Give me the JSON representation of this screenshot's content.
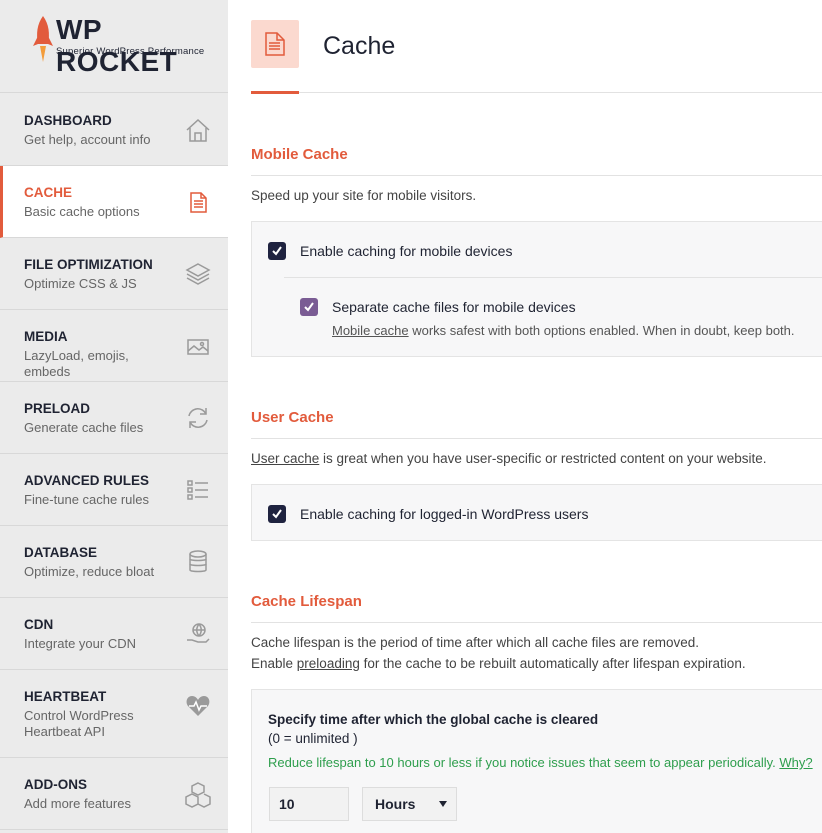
{
  "brand": {
    "logo_text": "WP ROCKET",
    "tagline": "Superior WordPress Performance",
    "accent_color": "#e25b3c"
  },
  "sidebar": {
    "items": [
      {
        "title": "DASHBOARD",
        "desc": "Get help, account info",
        "icon": "home-icon",
        "active": false
      },
      {
        "title": "CACHE",
        "desc": "Basic cache options",
        "icon": "file-icon",
        "active": true
      },
      {
        "title": "FILE OPTIMIZATION",
        "desc": "Optimize CSS & JS",
        "icon": "layers-icon",
        "active": false
      },
      {
        "title": "MEDIA",
        "desc": "LazyLoad, emojis, embeds",
        "icon": "images-icon",
        "active": false
      },
      {
        "title": "PRELOAD",
        "desc": "Generate cache files",
        "icon": "refresh-icon",
        "active": false
      },
      {
        "title": "ADVANCED RULES",
        "desc": "Fine-tune cache rules",
        "icon": "list-icon",
        "active": false
      },
      {
        "title": "DATABASE",
        "desc": "Optimize, reduce bloat",
        "icon": "database-icon",
        "active": false
      },
      {
        "title": "CDN",
        "desc": "Integrate your CDN",
        "icon": "globe-hand-icon",
        "active": false
      },
      {
        "title": "HEARTBEAT",
        "desc": "Control WordPress Heartbeat API",
        "icon": "heartbeat-icon",
        "active": false
      },
      {
        "title": "ADD-ONS",
        "desc": "Add more features",
        "icon": "cubes-icon",
        "active": false
      }
    ]
  },
  "page": {
    "title": "Cache"
  },
  "mobile_cache": {
    "title": "Mobile Cache",
    "desc": "Speed up your site for mobile visitors.",
    "opt1_label": "Enable caching for mobile devices",
    "opt1_checked": true,
    "opt2_label": "Separate cache files for mobile devices",
    "opt2_checked": true,
    "note_link": "Mobile cache",
    "note_rest": " works safest with both options enabled. When in doubt, keep both."
  },
  "user_cache": {
    "title": "User Cache",
    "desc_link": "User cache",
    "desc_rest": " is great when you have user-specific or restricted content on your website.",
    "opt_label": "Enable caching for logged-in WordPress users",
    "opt_checked": true
  },
  "lifespan": {
    "title": "Cache Lifespan",
    "desc_line1": "Cache lifespan is the period of time after which all cache files are removed.",
    "desc_line2_pre": "Enable ",
    "desc_line2_link": "preloading",
    "desc_line2_post": " for the cache to be rebuilt automatically after lifespan expiration.",
    "field_title": "Specify time after which the global cache is cleared",
    "field_sub": "(0 = unlimited )",
    "warning": "Reduce lifespan to 10 hours or less if you notice issues that seem to appear periodically. ",
    "warning_link": "Why?",
    "value": "10",
    "unit": "Hours"
  }
}
